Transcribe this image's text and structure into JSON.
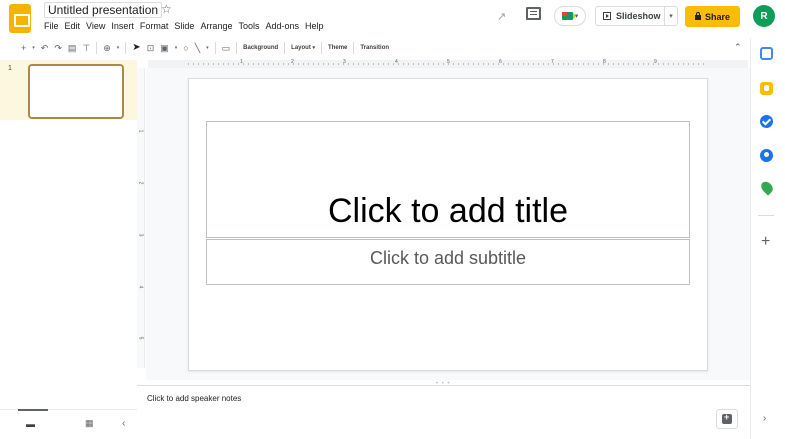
{
  "header": {
    "doc_title": "Untitled presentation",
    "menu": [
      "File",
      "Edit",
      "View",
      "Insert",
      "Format",
      "Slide",
      "Arrange",
      "Tools",
      "Add-ons",
      "Help"
    ],
    "slideshow_label": "Slideshow",
    "share_label": "Share",
    "avatar_initial": "R"
  },
  "toolbar": {
    "background_label": "Background",
    "layout_label": "Layout",
    "theme_label": "Theme",
    "transition_label": "Transition"
  },
  "ruler": {
    "h_numbers": [
      "1",
      "2",
      "3",
      "4",
      "5",
      "6",
      "7",
      "8",
      "9"
    ],
    "v_numbers": [
      "1",
      "2",
      "3",
      "4",
      "5"
    ]
  },
  "filmstrip": {
    "slide_number": "1"
  },
  "slide": {
    "title_placeholder": "Click to add title",
    "subtitle_placeholder": "Click to add subtitle"
  },
  "notes": {
    "placeholder": "Click to add speaker notes"
  },
  "icons": {
    "star": "star-icon",
    "activity": "activity-dashboard-icon",
    "comments": "comment-history-icon",
    "meet": "meet-icon",
    "calendar": "calendar-icon",
    "keep": "keep-icon",
    "tasks": "tasks-icon",
    "contacts": "contacts-icon",
    "maps": "maps-icon"
  },
  "colors": {
    "share": "#fbbc04",
    "avatar": "#0f9d58",
    "logo": "#f4b400",
    "selected_slide_bg": "#fef7e0"
  }
}
